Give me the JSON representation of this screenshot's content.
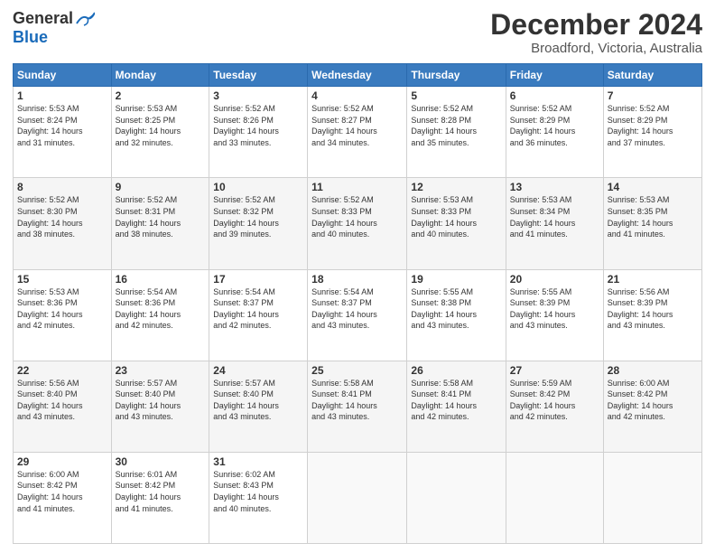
{
  "logo": {
    "general": "General",
    "blue": "Blue"
  },
  "title": "December 2024",
  "location": "Broadford, Victoria, Australia",
  "days_header": [
    "Sunday",
    "Monday",
    "Tuesday",
    "Wednesday",
    "Thursday",
    "Friday",
    "Saturday"
  ],
  "weeks": [
    [
      {
        "day": "1",
        "sunrise": "Sunrise: 5:53 AM",
        "sunset": "Sunset: 8:24 PM",
        "daylight": "Daylight: 14 hours",
        "minutes": "and 31 minutes."
      },
      {
        "day": "2",
        "sunrise": "Sunrise: 5:53 AM",
        "sunset": "Sunset: 8:25 PM",
        "daylight": "Daylight: 14 hours",
        "minutes": "and 32 minutes."
      },
      {
        "day": "3",
        "sunrise": "Sunrise: 5:52 AM",
        "sunset": "Sunset: 8:26 PM",
        "daylight": "Daylight: 14 hours",
        "minutes": "and 33 minutes."
      },
      {
        "day": "4",
        "sunrise": "Sunrise: 5:52 AM",
        "sunset": "Sunset: 8:27 PM",
        "daylight": "Daylight: 14 hours",
        "minutes": "and 34 minutes."
      },
      {
        "day": "5",
        "sunrise": "Sunrise: 5:52 AM",
        "sunset": "Sunset: 8:28 PM",
        "daylight": "Daylight: 14 hours",
        "minutes": "and 35 minutes."
      },
      {
        "day": "6",
        "sunrise": "Sunrise: 5:52 AM",
        "sunset": "Sunset: 8:29 PM",
        "daylight": "Daylight: 14 hours",
        "minutes": "and 36 minutes."
      },
      {
        "day": "7",
        "sunrise": "Sunrise: 5:52 AM",
        "sunset": "Sunset: 8:29 PM",
        "daylight": "Daylight: 14 hours",
        "minutes": "and 37 minutes."
      }
    ],
    [
      {
        "day": "8",
        "sunrise": "Sunrise: 5:52 AM",
        "sunset": "Sunset: 8:30 PM",
        "daylight": "Daylight: 14 hours",
        "minutes": "and 38 minutes."
      },
      {
        "day": "9",
        "sunrise": "Sunrise: 5:52 AM",
        "sunset": "Sunset: 8:31 PM",
        "daylight": "Daylight: 14 hours",
        "minutes": "and 38 minutes."
      },
      {
        "day": "10",
        "sunrise": "Sunrise: 5:52 AM",
        "sunset": "Sunset: 8:32 PM",
        "daylight": "Daylight: 14 hours",
        "minutes": "and 39 minutes."
      },
      {
        "day": "11",
        "sunrise": "Sunrise: 5:52 AM",
        "sunset": "Sunset: 8:33 PM",
        "daylight": "Daylight: 14 hours",
        "minutes": "and 40 minutes."
      },
      {
        "day": "12",
        "sunrise": "Sunrise: 5:53 AM",
        "sunset": "Sunset: 8:33 PM",
        "daylight": "Daylight: 14 hours",
        "minutes": "and 40 minutes."
      },
      {
        "day": "13",
        "sunrise": "Sunrise: 5:53 AM",
        "sunset": "Sunset: 8:34 PM",
        "daylight": "Daylight: 14 hours",
        "minutes": "and 41 minutes."
      },
      {
        "day": "14",
        "sunrise": "Sunrise: 5:53 AM",
        "sunset": "Sunset: 8:35 PM",
        "daylight": "Daylight: 14 hours",
        "minutes": "and 41 minutes."
      }
    ],
    [
      {
        "day": "15",
        "sunrise": "Sunrise: 5:53 AM",
        "sunset": "Sunset: 8:36 PM",
        "daylight": "Daylight: 14 hours",
        "minutes": "and 42 minutes."
      },
      {
        "day": "16",
        "sunrise": "Sunrise: 5:54 AM",
        "sunset": "Sunset: 8:36 PM",
        "daylight": "Daylight: 14 hours",
        "minutes": "and 42 minutes."
      },
      {
        "day": "17",
        "sunrise": "Sunrise: 5:54 AM",
        "sunset": "Sunset: 8:37 PM",
        "daylight": "Daylight: 14 hours",
        "minutes": "and 42 minutes."
      },
      {
        "day": "18",
        "sunrise": "Sunrise: 5:54 AM",
        "sunset": "Sunset: 8:37 PM",
        "daylight": "Daylight: 14 hours",
        "minutes": "and 43 minutes."
      },
      {
        "day": "19",
        "sunrise": "Sunrise: 5:55 AM",
        "sunset": "Sunset: 8:38 PM",
        "daylight": "Daylight: 14 hours",
        "minutes": "and 43 minutes."
      },
      {
        "day": "20",
        "sunrise": "Sunrise: 5:55 AM",
        "sunset": "Sunset: 8:39 PM",
        "daylight": "Daylight: 14 hours",
        "minutes": "and 43 minutes."
      },
      {
        "day": "21",
        "sunrise": "Sunrise: 5:56 AM",
        "sunset": "Sunset: 8:39 PM",
        "daylight": "Daylight: 14 hours",
        "minutes": "and 43 minutes."
      }
    ],
    [
      {
        "day": "22",
        "sunrise": "Sunrise: 5:56 AM",
        "sunset": "Sunset: 8:40 PM",
        "daylight": "Daylight: 14 hours",
        "minutes": "and 43 minutes."
      },
      {
        "day": "23",
        "sunrise": "Sunrise: 5:57 AM",
        "sunset": "Sunset: 8:40 PM",
        "daylight": "Daylight: 14 hours",
        "minutes": "and 43 minutes."
      },
      {
        "day": "24",
        "sunrise": "Sunrise: 5:57 AM",
        "sunset": "Sunset: 8:40 PM",
        "daylight": "Daylight: 14 hours",
        "minutes": "and 43 minutes."
      },
      {
        "day": "25",
        "sunrise": "Sunrise: 5:58 AM",
        "sunset": "Sunset: 8:41 PM",
        "daylight": "Daylight: 14 hours",
        "minutes": "and 43 minutes."
      },
      {
        "day": "26",
        "sunrise": "Sunrise: 5:58 AM",
        "sunset": "Sunset: 8:41 PM",
        "daylight": "Daylight: 14 hours",
        "minutes": "and 42 minutes."
      },
      {
        "day": "27",
        "sunrise": "Sunrise: 5:59 AM",
        "sunset": "Sunset: 8:42 PM",
        "daylight": "Daylight: 14 hours",
        "minutes": "and 42 minutes."
      },
      {
        "day": "28",
        "sunrise": "Sunrise: 6:00 AM",
        "sunset": "Sunset: 8:42 PM",
        "daylight": "Daylight: 14 hours",
        "minutes": "and 42 minutes."
      }
    ],
    [
      {
        "day": "29",
        "sunrise": "Sunrise: 6:00 AM",
        "sunset": "Sunset: 8:42 PM",
        "daylight": "Daylight: 14 hours",
        "minutes": "and 41 minutes."
      },
      {
        "day": "30",
        "sunrise": "Sunrise: 6:01 AM",
        "sunset": "Sunset: 8:42 PM",
        "daylight": "Daylight: 14 hours",
        "minutes": "and 41 minutes."
      },
      {
        "day": "31",
        "sunrise": "Sunrise: 6:02 AM",
        "sunset": "Sunset: 8:43 PM",
        "daylight": "Daylight: 14 hours",
        "minutes": "and 40 minutes."
      },
      null,
      null,
      null,
      null
    ]
  ]
}
